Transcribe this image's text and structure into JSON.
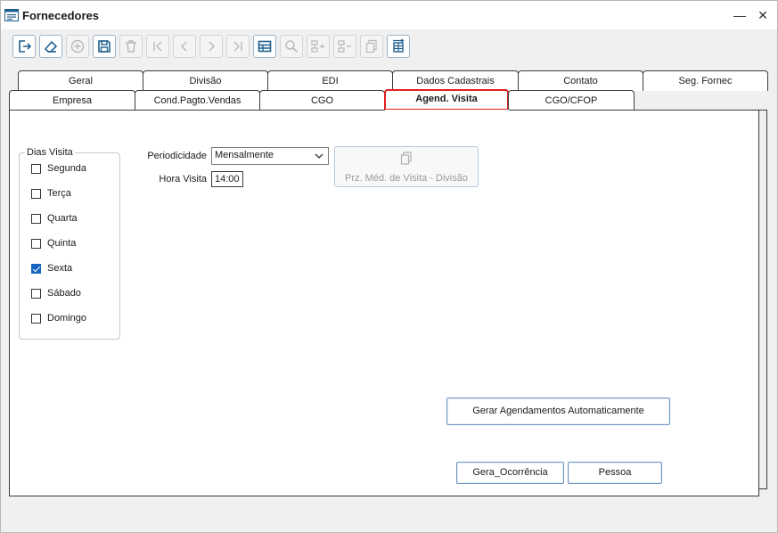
{
  "window": {
    "title": "Fornecedores",
    "minimize_glyph": "—",
    "close_glyph": "✕"
  },
  "toolbar": {
    "buttons": [
      {
        "icon": "exit-icon",
        "enabled": true
      },
      {
        "icon": "eraser-icon",
        "enabled": true
      },
      {
        "icon": "add-icon",
        "enabled": false
      },
      {
        "icon": "save-icon",
        "enabled": true
      },
      {
        "icon": "delete-icon",
        "enabled": false
      },
      {
        "icon": "first-record-icon",
        "enabled": false
      },
      {
        "icon": "previous-record-icon",
        "enabled": false
      },
      {
        "icon": "next-record-icon",
        "enabled": false
      },
      {
        "icon": "last-record-icon",
        "enabled": false
      },
      {
        "icon": "table-view-icon",
        "enabled": true
      },
      {
        "icon": "search-icon",
        "enabled": false
      },
      {
        "icon": "insert-row-icon",
        "enabled": false
      },
      {
        "icon": "remove-row-icon",
        "enabled": false
      },
      {
        "icon": "copy-icon",
        "enabled": false
      },
      {
        "icon": "transfer-icon",
        "enabled": true
      }
    ]
  },
  "tabs": {
    "row1": [
      "Geral",
      "Divisão",
      "EDI",
      "Dados Cadastrais",
      "Contato",
      "Seg. Fornec"
    ],
    "row2": [
      "Empresa",
      "Cond.Pagto.Vendas",
      "CGO",
      "Agend. Visita",
      "CGO/CFOP"
    ],
    "active": "Agend. Visita"
  },
  "dias_visita": {
    "title": "Dias Visita",
    "days": [
      {
        "label": "Segunda",
        "checked": false
      },
      {
        "label": "Terça",
        "checked": false
      },
      {
        "label": "Quarta",
        "checked": false
      },
      {
        "label": "Quinta",
        "checked": false
      },
      {
        "label": "Sexta",
        "checked": true
      },
      {
        "label": "Sábado",
        "checked": false
      },
      {
        "label": "Domingo",
        "checked": false
      }
    ]
  },
  "form": {
    "periodicidade_label": "Periodicidade",
    "periodicidade_value": "Mensalmente",
    "hora_visita_label": "Hora Visita",
    "hora_visita_value": "14:00"
  },
  "buttons": {
    "prz_medio": "Prz. Méd. de Visita - Divisão",
    "gerar_agendamentos": "Gerar Agendamentos Automaticamente",
    "gera_ocorrencia": "Gera_Ocorrência",
    "pessoa": "Pessoa"
  },
  "colors": {
    "active_tab_border": "#e02020",
    "icon_blue": "#1f5f8f",
    "checkbox_checked": "#1565c0"
  }
}
